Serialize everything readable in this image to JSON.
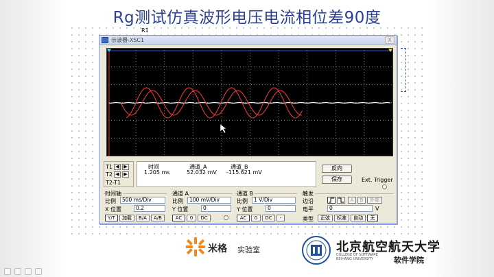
{
  "slide": {
    "title": "Rg测试仿真波形电压电流相位差90度",
    "label_r1": "R1"
  },
  "window": {
    "title": "示波器-XSC1",
    "close_label": "X"
  },
  "cursors": {
    "t1_label": "T1",
    "t2_label": "T2",
    "t2t1_label": "T2-T1",
    "left_arrow": "◀",
    "right_arrow": "▶"
  },
  "readout": {
    "headers": {
      "time": "时间",
      "channel_a": "通道_A",
      "channel_b": "通道_B"
    },
    "values": {
      "time": "1.205 ms",
      "channel_a": "52.032 mV",
      "channel_b": "-115.621 mV"
    }
  },
  "buttons": {
    "reverse": "反向",
    "save": "保存",
    "ext_trigger": "Ext. Trigger"
  },
  "timebase": {
    "title": "时间轴",
    "scale_label": "比例",
    "scale_value": "500 ms/Div",
    "xpos_label": "X 位置",
    "xpos_value": "0.2",
    "modes": [
      "Y/T",
      "加载",
      "B/A",
      "A/B"
    ]
  },
  "channel_a": {
    "title": "通道 A",
    "scale_label": "比例",
    "scale_value": "100 mV/Div",
    "ypos_label": "Y 位置",
    "ypos_value": "0",
    "coupling": [
      "AC",
      "0",
      "DC"
    ]
  },
  "channel_b": {
    "title": "通道 B",
    "scale_label": "比例",
    "scale_value": "1 V/Div",
    "ypos_label": "Y 位置",
    "ypos_value": "0",
    "coupling": [
      "AC",
      "0",
      "DC",
      "-"
    ]
  },
  "trigger": {
    "title": "触发",
    "edge_label": "边沿",
    "level_label": "电平",
    "level_value": "0",
    "level_unit": "V",
    "type_label": "类型",
    "edge_options": [
      "A",
      "B",
      "外部"
    ],
    "type_options": [
      "正弦",
      "标准",
      "自动",
      "无"
    ]
  },
  "logos": {
    "mige_name": "米格",
    "mige_sub": "实验室",
    "buaa_name": "北京航空航天大学",
    "buaa_en_1": "COLLEGE OF SOFTWARE",
    "buaa_en_2": "BEIHANG UNIVERSITY",
    "buaa_sub": "软件学院"
  },
  "colors": {
    "title_text": "#2a3f95",
    "scope_background": "#000000",
    "grid_dots": "#9a9a9a",
    "trace_a": "#e83a3a",
    "trace_b": "#ffffff",
    "marker": "#3a58c8"
  }
}
